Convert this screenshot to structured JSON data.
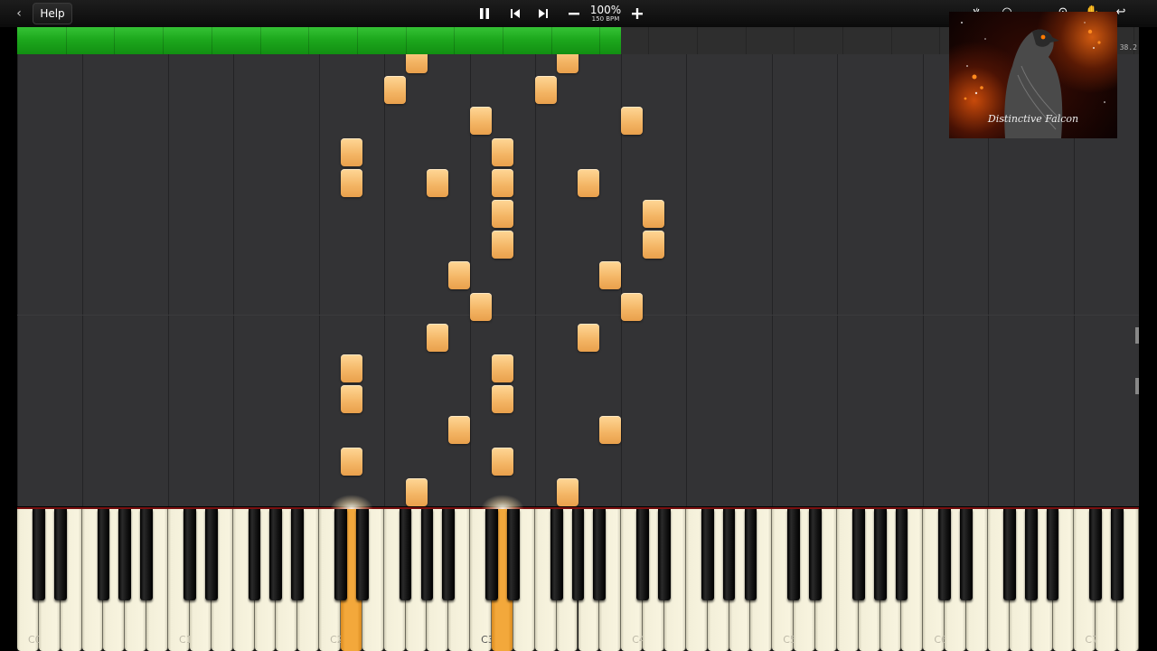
{
  "toolbar": {
    "back_glyph": "‹",
    "help_label": "Help",
    "speed_value": "100%",
    "speed_bpm": "150 BPM",
    "icons": [
      "pause-icon",
      "skip-back-icon",
      "skip-forward-icon",
      "minus-icon",
      "plus-icon"
    ]
  },
  "progress": {
    "fraction": 0.538,
    "time_readout": "38.2"
  },
  "album_art": {
    "caption": "Distinctive Falcon"
  },
  "keyboard": {
    "start_note": "C0",
    "white_key_count": 52,
    "octave_labels": [
      "C0",
      "C1",
      "C2",
      "C3",
      "C4",
      "C5",
      "C6",
      "C7"
    ],
    "pressed_white_keys": [
      15,
      22
    ]
  },
  "notes": [
    {
      "key": 18,
      "row": 0
    },
    {
      "key": 25,
      "row": 0
    },
    {
      "key": 17,
      "row": 1
    },
    {
      "key": 24,
      "row": 1
    },
    {
      "key": 21,
      "row": 2
    },
    {
      "key": 28,
      "row": 2
    },
    {
      "key": 15,
      "row": 3
    },
    {
      "key": 22,
      "row": 3
    },
    {
      "key": 15,
      "row": 4
    },
    {
      "key": 19,
      "row": 4
    },
    {
      "key": 22,
      "row": 4
    },
    {
      "key": 26,
      "row": 4
    },
    {
      "key": 22,
      "row": 5
    },
    {
      "key": 29,
      "row": 5
    },
    {
      "key": 22,
      "row": 6
    },
    {
      "key": 29,
      "row": 6
    },
    {
      "key": 20,
      "row": 7
    },
    {
      "key": 27,
      "row": 7
    },
    {
      "key": 21,
      "row": 8
    },
    {
      "key": 28,
      "row": 8
    },
    {
      "key": 19,
      "row": 9
    },
    {
      "key": 26,
      "row": 9
    },
    {
      "key": 15,
      "row": 10
    },
    {
      "key": 22,
      "row": 10
    },
    {
      "key": 15,
      "row": 11
    },
    {
      "key": 22,
      "row": 11
    },
    {
      "key": 20,
      "row": 12
    },
    {
      "key": 27,
      "row": 12
    },
    {
      "key": 15,
      "row": 13
    },
    {
      "key": 22,
      "row": 13
    },
    {
      "key": 18,
      "row": 14
    },
    {
      "key": 25,
      "row": 14
    }
  ]
}
